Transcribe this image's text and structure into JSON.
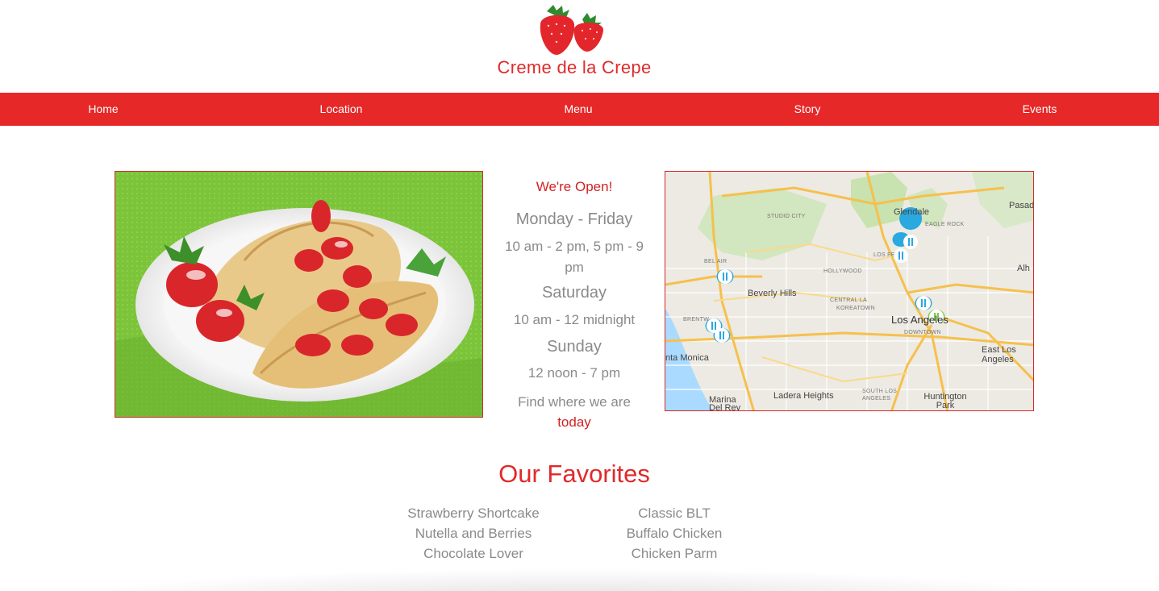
{
  "brand": {
    "name": "Creme de la Crepe",
    "logo_icon": "strawberries-logo"
  },
  "nav": {
    "items": [
      {
        "label": "Home"
      },
      {
        "label": "Location"
      },
      {
        "label": "Menu"
      },
      {
        "label": "Story"
      },
      {
        "label": "Events"
      }
    ]
  },
  "hours": {
    "open_label": "We're Open!",
    "schedule": [
      {
        "day": "Monday - Friday",
        "time": "10 am - 2 pm, 5 pm - 9 pm"
      },
      {
        "day": "Saturday",
        "time": "10 am - 12 midnight"
      },
      {
        "day": "Sunday",
        "time": "12 noon - 7 pm"
      }
    ],
    "find_text": "Find where we are",
    "find_link": "today"
  },
  "map": {
    "labels": {
      "glendale": "Glendale",
      "pasadena": "Pasade",
      "eagle_rock": "EAGLE ROCK",
      "studio_city": "STUDIO CITY",
      "bel_air": "BEL AIR",
      "hollywood": "HOLLYWOOD",
      "los_feliz": "LOS FE",
      "beverly_hills": "Beverly Hills",
      "central_la": "CENTRAL LA",
      "koreatown": "KOREATOWN",
      "los_angeles": "Los Angeles",
      "downtown": "DOWNTOWN",
      "brentwood": "BRENTW",
      "santa_monica": "nta Monica",
      "east_la": "East Los Angeles",
      "alhambra": "Alh",
      "ladera_heights": "Ladera Heights",
      "south_la": "SOUTH LOS ANGELES",
      "huntington_park": "Huntington Park",
      "marina": "Marina Del Rey"
    },
    "pin_icon": "restaurant-pin-icon",
    "active_pin_icon": "active-restaurant-pin-icon"
  },
  "favorites": {
    "title": "Our Favorites",
    "left": [
      "Strawberry Shortcake",
      "Nutella and Berries",
      "Chocolate Lover"
    ],
    "right": [
      "Classic BLT",
      "Buffalo Chicken",
      "Chicken Parm"
    ]
  },
  "colors": {
    "brand_red": "#e62828",
    "text_gray": "#8a8a8a",
    "pin_blue": "#2aa9e0",
    "pin_green": "#7ac943"
  }
}
